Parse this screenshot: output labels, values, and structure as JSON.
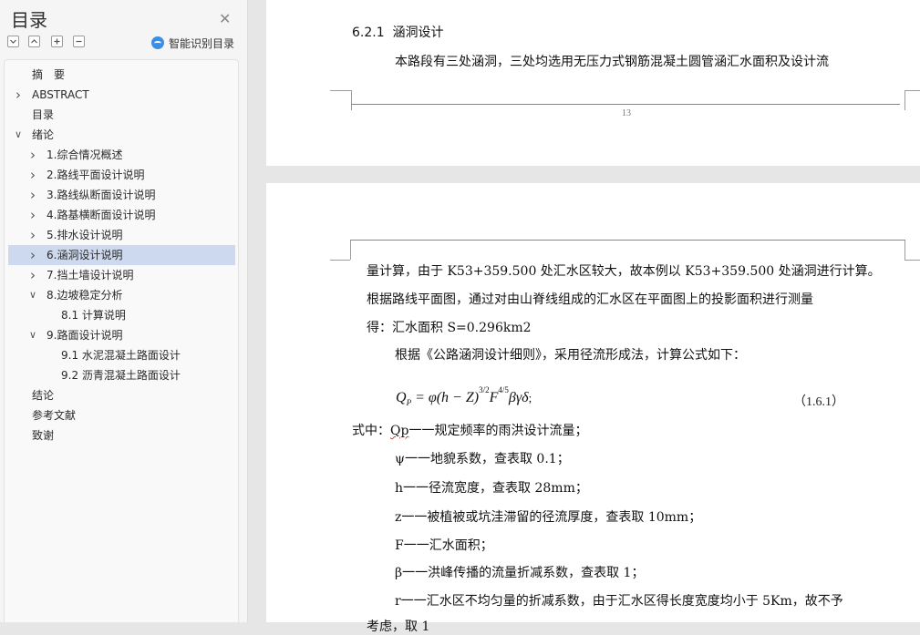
{
  "panel": {
    "title": "目录",
    "close_icon": "close-icon",
    "toolbar": {
      "icons": [
        "collapse-all-icon",
        "expand-all-icon",
        "add-icon",
        "remove-icon"
      ]
    },
    "smart_label": "智能识别目录",
    "items": [
      {
        "label": "摘　要",
        "level": 0,
        "arrow": "",
        "selected": false
      },
      {
        "label": "ABSTRACT",
        "level": 0,
        "arrow": "right",
        "selected": false
      },
      {
        "label": "目录",
        "level": 0,
        "arrow": "",
        "selected": false
      },
      {
        "label": "绪论",
        "level": 0,
        "arrow": "down",
        "selected": false
      },
      {
        "label": "1.综合情况概述",
        "level": 1,
        "arrow": "right",
        "selected": false
      },
      {
        "label": "2.路线平面设计说明",
        "level": 1,
        "arrow": "right",
        "selected": false
      },
      {
        "label": "3.路线纵断面设计说明",
        "level": 1,
        "arrow": "right",
        "selected": false
      },
      {
        "label": "4.路基横断面设计说明",
        "level": 1,
        "arrow": "right",
        "selected": false
      },
      {
        "label": "5.排水设计说明",
        "level": 1,
        "arrow": "right",
        "selected": false
      },
      {
        "label": "6.涵洞设计说明",
        "level": 1,
        "arrow": "right",
        "selected": true
      },
      {
        "label": "7.挡土墙设计说明",
        "level": 1,
        "arrow": "right",
        "selected": false
      },
      {
        "label": "8.边坡稳定分析",
        "level": 1,
        "arrow": "down",
        "selected": false
      },
      {
        "label": "8.1 计算说明",
        "level": 2,
        "arrow": "",
        "selected": false
      },
      {
        "label": "9.路面设计说明",
        "level": 1,
        "arrow": "down",
        "selected": false
      },
      {
        "label": "9.1 水泥混凝土路面设计",
        "level": 2,
        "arrow": "",
        "selected": false
      },
      {
        "label": "9.2 沥青混凝土路面设计",
        "level": 2,
        "arrow": "",
        "selected": false
      },
      {
        "label": "结论",
        "level": 0,
        "arrow": "",
        "selected": false
      },
      {
        "label": "参考文献",
        "level": 0,
        "arrow": "",
        "selected": false
      },
      {
        "label": "致谢",
        "level": 0,
        "arrow": "",
        "selected": false
      }
    ]
  },
  "page1": {
    "heading_num": "6.2.1",
    "heading_text": "涵洞设计",
    "line1": "本路段有三处涵洞，三处均选用无压力式钢筋混凝土圆管涵汇水面积及设计流",
    "page_number": "13"
  },
  "page2": {
    "lines": [
      "量计算，由于 K53+359.500 处汇水区较大，故本例以 K53+359.500 处涵洞进行计算。",
      "根据路线平面图，通过对由山脊线组成的汇水区在平面图上的投影面积进行测量",
      "得：汇水面积 S=0.296km2",
      "根据《公路涵洞设计细则》，采用径流形成法，计算公式如下："
    ],
    "formula": {
      "lhs": "Q",
      "lhs_sub": "P",
      "rhs_a": " = φ(h − Z)",
      "exp1": "3/2",
      "rhs_b": "F",
      "exp2": "4/5",
      "rhs_c": "βγδ",
      "tail": ";"
    },
    "eq_number": "（1.6.1）",
    "where_prefix": "式中：",
    "defs": [
      {
        "sym": "Qp",
        "text": "一一规定频率的雨洪设计流量；"
      },
      {
        "sym": "ψ",
        "text": "一一地貌系数，查表取 0.1；"
      },
      {
        "sym": "h",
        "text": "一一径流宽度，查表取 28mm；"
      },
      {
        "sym": "z",
        "text": "一一被植被或坑洼滞留的径流厚度，查表取 10mm；"
      },
      {
        "sym": "F",
        "text": "一一汇水面积；"
      },
      {
        "sym": "β",
        "text": "一一洪峰传播的流量折减系数，查表取 1；"
      },
      {
        "sym": "r",
        "text": "一一汇水区不均匀量的折减系数，由于汇水区得长度宽度均小于 5Km，故不予"
      }
    ],
    "cut_line": "考虑，取 1"
  }
}
